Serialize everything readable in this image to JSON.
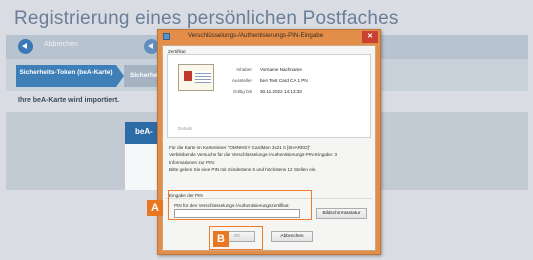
{
  "background": {
    "title": "Registrierung eines persönlichen Postfaches",
    "toolbar": {
      "back_label": "Abbrechen"
    },
    "steps": [
      {
        "label": "Sicherheits-Token (beA-Karte)"
      },
      {
        "label": "Sicherhe"
      }
    ],
    "status": "Ihre beA-Karte wird importiert.",
    "card_title": "beA-"
  },
  "dialog": {
    "title": "Verschlüsselungs-/Authentisierungs-PIN-Eingabe",
    "close_label": "✕",
    "certificate": {
      "group_label": "Zertifikat",
      "rows": [
        {
          "label": "Inhaber",
          "value": "Vorname Nachname"
        },
        {
          "label": "Aussteller",
          "value": "beA Test Card CA 1 PN"
        },
        {
          "label": "Gültig bis",
          "value": "30.11.2022 14:13:33"
        }
      ],
      "details_label": "Details"
    },
    "info_lines": [
      "Für die Karte im Kartenleser \"OMNIKEY CardMan 3x21 0 [SHARED]\"",
      "Verbleibende Versuche für die Verschlüsselungs-/Authentisierungs-PIN-Eingabe: 3",
      "Informationen zur PIN:",
      "Bitte geben Sie eine PIN mit mindestens 6 und höchstens 12 Stellen ein."
    ],
    "pin": {
      "group_label": "Eingabe der PIN",
      "field_label": "PIN für den Verschlüsselungs-/Authentisierungszertifikat:",
      "value": ""
    },
    "buttons": {
      "screen_keyboard": "Bildschirmtastatur",
      "ok": "OK",
      "cancel": "Abbrechen"
    }
  },
  "annotations": {
    "marker_a": "A",
    "marker_b": "B"
  },
  "colors": {
    "accent": "#e87722",
    "titlebar": "#e28e49",
    "brand_blue": "#3f7fb8"
  }
}
